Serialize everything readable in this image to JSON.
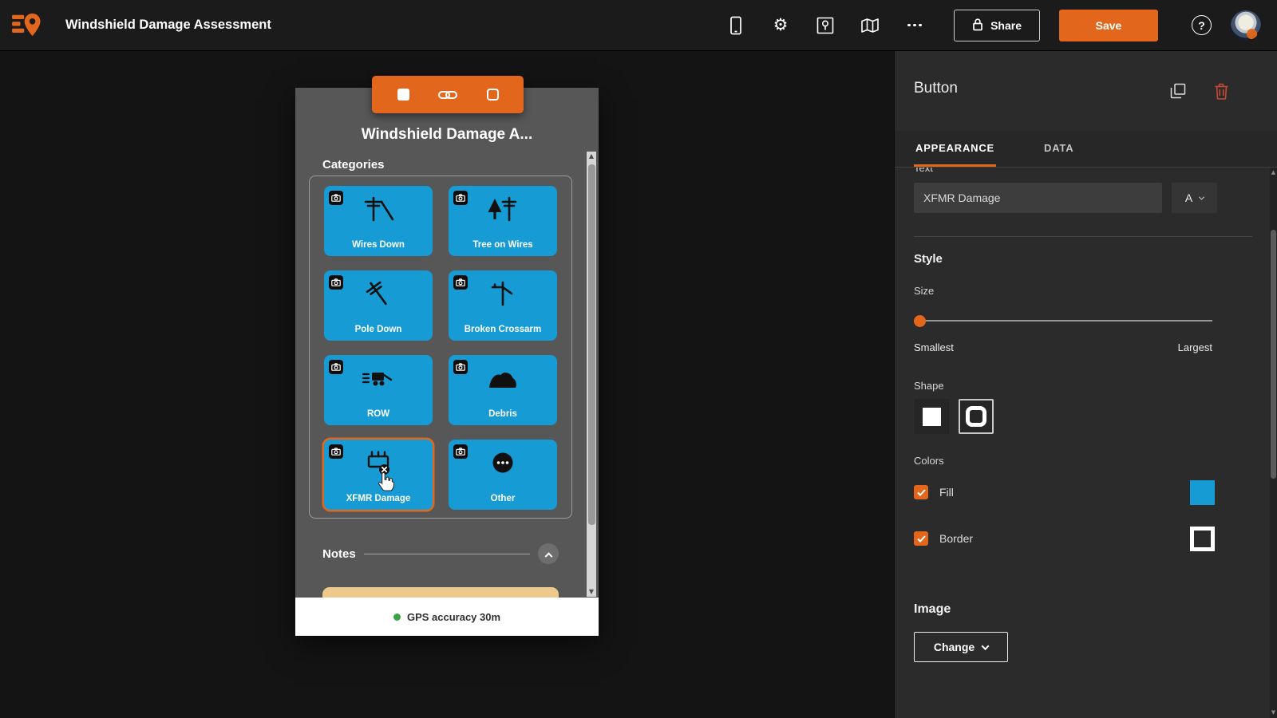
{
  "theme": {
    "accent": "#e2671c",
    "button_blue": "#169bd5",
    "gps_green": "#3aa546",
    "notes_tan": "#eec98c"
  },
  "icons": {
    "gear": "⚙",
    "arrow_up": "▲",
    "arrow_down": "▼"
  },
  "header": {
    "title": "Windshield Damage Assessment",
    "share_label": "Share",
    "save_label": "Save",
    "help_label": "?"
  },
  "phone": {
    "title": "Windshield Damage A...",
    "categories_label": "Categories",
    "notes_label": "Notes",
    "gps_text": "GPS accuracy 30m",
    "buttons": [
      {
        "label": "Wires Down",
        "icon": "wires-down-icon"
      },
      {
        "label": "Tree on Wires",
        "icon": "tree-on-wires-icon"
      },
      {
        "label": "Pole Down",
        "icon": "pole-down-icon"
      },
      {
        "label": "Broken Crossarm",
        "icon": "broken-crossarm-icon"
      },
      {
        "label": "ROW",
        "icon": "row-icon"
      },
      {
        "label": "Debris",
        "icon": "debris-icon"
      },
      {
        "label": "XFMR Damage",
        "icon": "xfmr-damage-icon",
        "selected": true
      },
      {
        "label": "Other",
        "icon": "other-icon"
      }
    ]
  },
  "panel": {
    "title": "Button",
    "tabs": {
      "appearance": "APPEARANCE",
      "data": "DATA"
    },
    "text": {
      "label": "Text",
      "value": "XFMR Damage",
      "font_toggle": "A"
    },
    "style": {
      "heading": "Style",
      "size_label": "Size",
      "size_min": "Smallest",
      "size_max": "Largest",
      "shape_label": "Shape"
    },
    "colors": {
      "heading": "Colors",
      "fill_label": "Fill",
      "border_label": "Border",
      "fill_swatch": "#169bd5",
      "border_swatch": "#ffffff"
    },
    "image": {
      "heading": "Image",
      "change_label": "Change"
    }
  }
}
